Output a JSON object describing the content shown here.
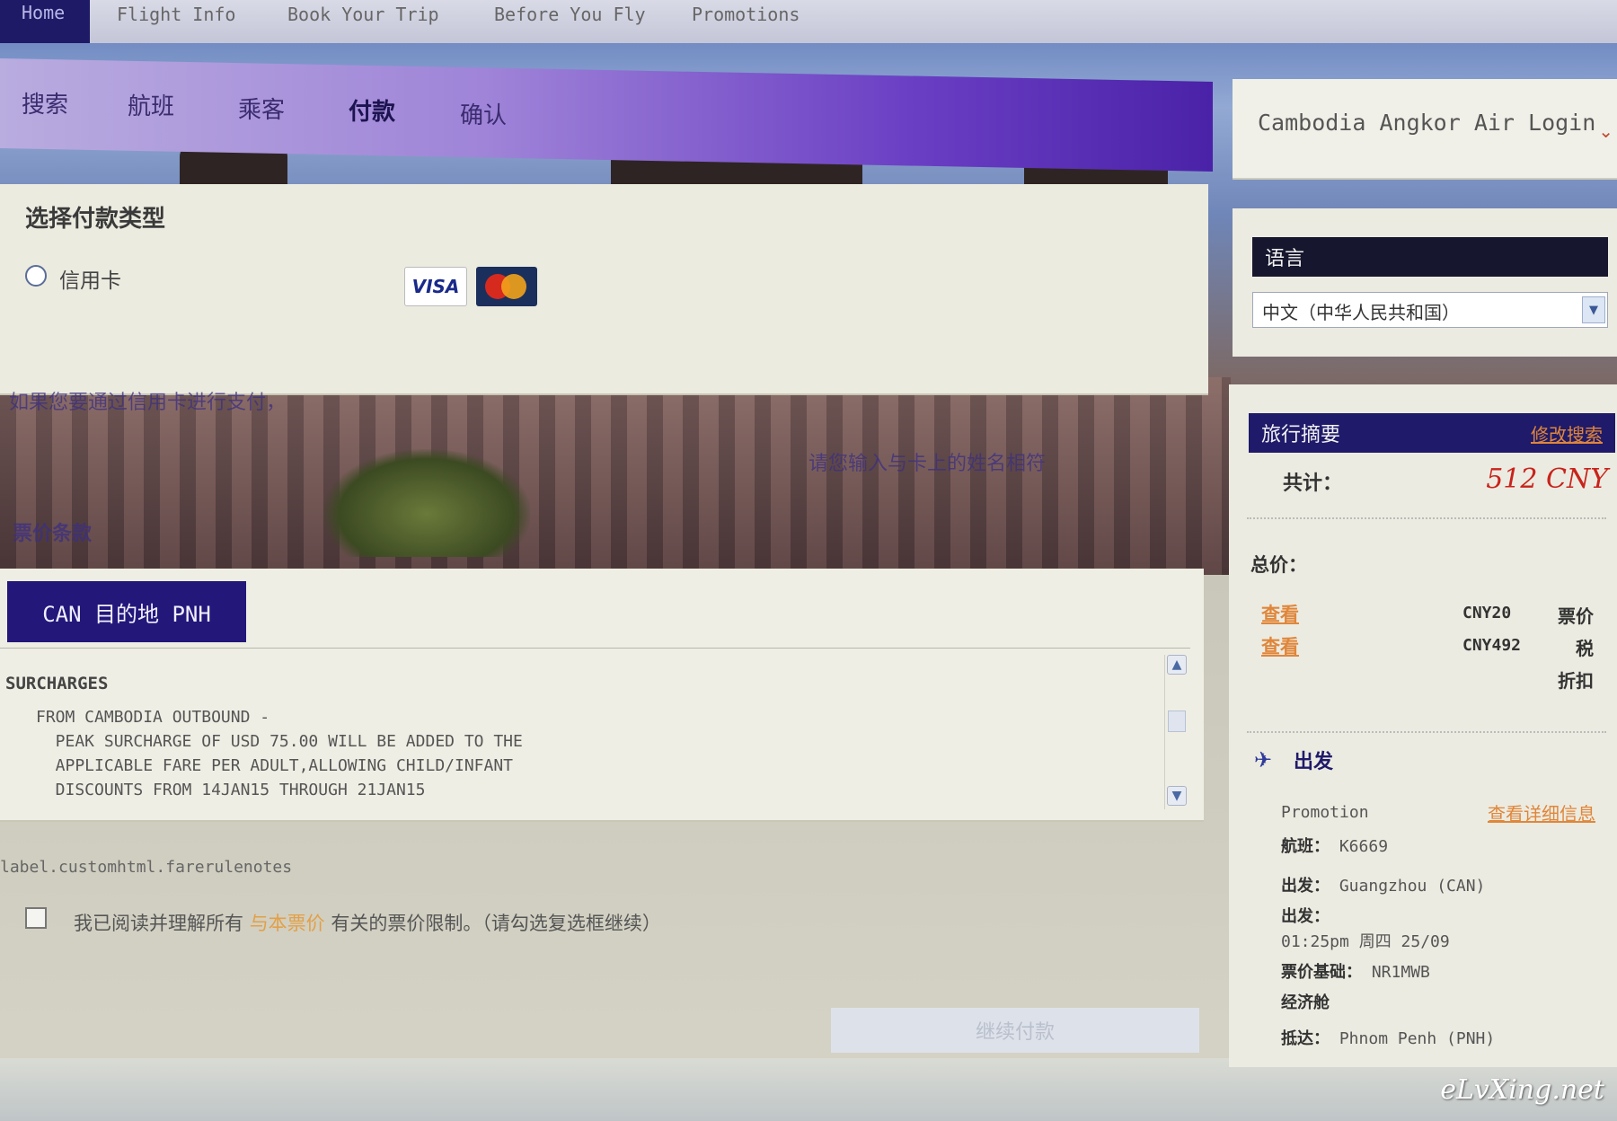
{
  "top_nav": {
    "items": [
      "Home",
      "Flight Info",
      "Book Your Trip",
      "Before You Fly",
      "Promotions"
    ]
  },
  "steps": [
    "搜索",
    "航班",
    "乘客",
    "付款",
    "确认"
  ],
  "active_step": "付款",
  "payment": {
    "title": "选择付款类型",
    "option_label": "信用卡",
    "card_logos": [
      "VISA",
      "MasterCard"
    ]
  },
  "background_text": {
    "line1": "如果您要通过信用卡进行支付，",
    "line2": "请您输入与卡上的姓名相符",
    "line3": "票价条款"
  },
  "fare_rules": {
    "route_tab": "CAN 目的地 PNH",
    "section": "SURCHARGES",
    "lines": [
      "FROM CAMBODIA OUTBOUND -",
      "  PEAK SURCHARGE OF USD 75.00 WILL BE ADDED TO THE",
      "  APPLICABLE FARE PER ADULT,ALLOWING CHILD/INFANT",
      "  DISCOUNTS FROM 14JAN15 THROUGH 21JAN15"
    ]
  },
  "label_note": "label.customhtml.farerulenotes",
  "agree": {
    "before": "我已阅读并理解所有",
    "link": "与本票价",
    "after": "有关的票价限制。（请勾选复选框继续）"
  },
  "continue_button": "继续付款",
  "sidebar": {
    "login": "Cambodia Angkor Air Login",
    "language_header": "语言",
    "language_selected": "中文（中华人民共和国）",
    "summary_header": "旅行摘要",
    "modify_search": "修改搜索",
    "total_label": "共计：",
    "total_value": "512 CNY",
    "price_label": "总价：",
    "price_rows": [
      {
        "link": "查看",
        "amount": "CNY20",
        "label": "票价"
      },
      {
        "link": "查看",
        "amount": "CNY492",
        "label": "税"
      }
    ],
    "discount_label": "折扣",
    "depart_label": "出发",
    "fare_type": "Promotion",
    "details_link": "查看详细信息",
    "flight_label": "航班：",
    "flight_no": "K6669",
    "from_label": "出发：",
    "from_value": "Guangzhou (CAN)",
    "time_label": "出发：",
    "time_value": "01:25pm 周四 25/09",
    "fare_basis_label": "票价基础：",
    "fare_basis_value": "NR1MWB",
    "cabin": "经济舱",
    "arrive_label": "抵达：",
    "arrive_value": "Phnom Penh (PNH)"
  },
  "watermark": "eLvXing.net",
  "colors": {
    "brand_dark": "#1f1a6a",
    "step_purple": "#6b3fc4",
    "link_orange": "#e0863a",
    "price_red": "#c8231b"
  }
}
